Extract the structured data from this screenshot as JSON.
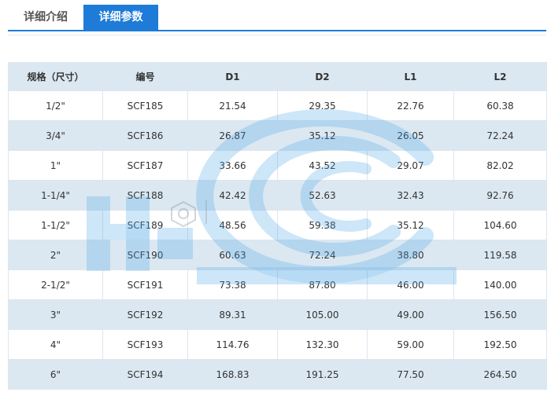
{
  "tabs": [
    {
      "label": "详细介绍",
      "active": false
    },
    {
      "label": "详细参数",
      "active": true
    }
  ],
  "colors": {
    "accent": "#1e7bd8",
    "row_stripe": "#dbe8f1",
    "watermark": "#4aa3e6"
  },
  "table": {
    "headers": [
      "规格（尺寸）",
      "编号",
      "D1",
      "D2",
      "L1",
      "L2"
    ],
    "rows": [
      [
        "1/2\"",
        "SCF185",
        "21.54",
        "29.35",
        "22.76",
        "60.38"
      ],
      [
        "3/4\"",
        "SCF186",
        "26.87",
        "35.12",
        "26.05",
        "72.24"
      ],
      [
        "1\"",
        "SCF187",
        "33.66",
        "43.52",
        "29.07",
        "82.02"
      ],
      [
        "1-1/4\"",
        "SCF188",
        "42.42",
        "52.63",
        "32.43",
        "92.76"
      ],
      [
        "1-1/2\"",
        "SCF189",
        "48.56",
        "59.38",
        "35.12",
        "104.60"
      ],
      [
        "2\"",
        "SCF190",
        "60.63",
        "72.24",
        "38.80",
        "119.58"
      ],
      [
        "2-1/2\"",
        "SCF191",
        "73.38",
        "87.80",
        "46.00",
        "140.00"
      ],
      [
        "3\"",
        "SCF192",
        "89.31",
        "105.00",
        "49.00",
        "156.50"
      ],
      [
        "4\"",
        "SCF193",
        "114.76",
        "132.30",
        "59.00",
        "192.50"
      ],
      [
        "6\"",
        "SCF194",
        "168.83",
        "191.25",
        "77.50",
        "264.50"
      ]
    ]
  }
}
